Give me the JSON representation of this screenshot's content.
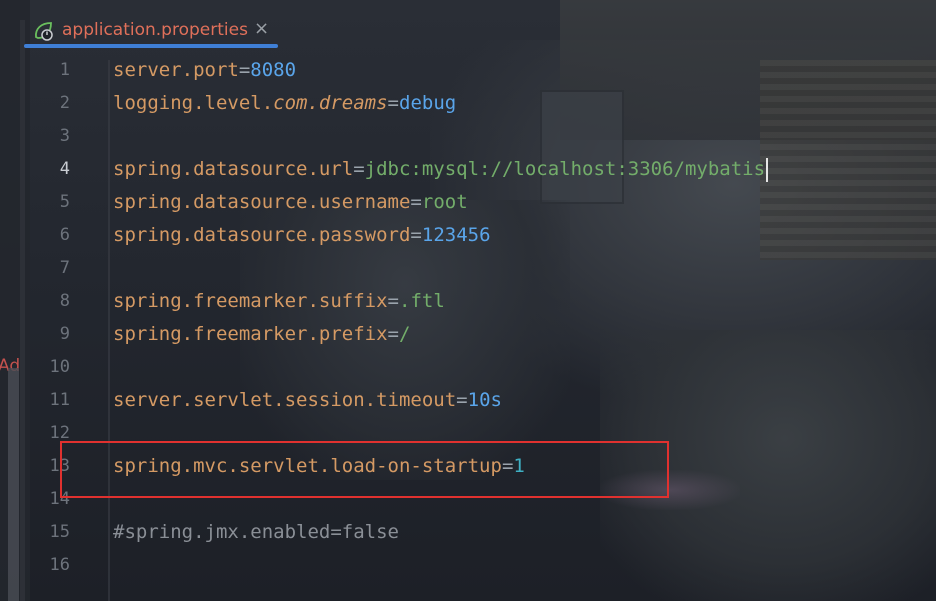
{
  "tab": {
    "label": "application.properties",
    "close": "×",
    "icon": "spring-leaf-icon"
  },
  "sidebar": {
    "cut_text": "Ad"
  },
  "editor": {
    "active_line": 4,
    "lines": [
      {
        "n": "1",
        "key": "server.port",
        "eq": "=",
        "value": "8080"
      },
      {
        "n": "2",
        "key_a": "logging.level.",
        "key_b": "com.dreams",
        "eq": "=",
        "value": "debug"
      },
      {
        "n": "3"
      },
      {
        "n": "4",
        "key": "spring.datasource.url",
        "eq": "=",
        "value": "jdbc:mysql://localhost:3306/mybatis"
      },
      {
        "n": "5",
        "key": "spring.datasource.username",
        "eq": "=",
        "value": "root"
      },
      {
        "n": "6",
        "key": "spring.datasource.password",
        "eq": "=",
        "value": "123456"
      },
      {
        "n": "7"
      },
      {
        "n": "8",
        "key": "spring.freemarker.suffix",
        "eq": "=",
        "value": ".ftl"
      },
      {
        "n": "9",
        "key": "spring.freemarker.prefix",
        "eq": "=",
        "value": "/"
      },
      {
        "n": "10"
      },
      {
        "n": "11",
        "key": "server.servlet.session.timeout",
        "eq": "=",
        "value": "10s"
      },
      {
        "n": "12"
      },
      {
        "n": "13",
        "key": "spring.mvc.servlet.load-on-startup",
        "eq": "=",
        "value": "1"
      },
      {
        "n": "14"
      },
      {
        "n": "15",
        "comment": "#spring.jmx.enabled=false"
      },
      {
        "n": "16"
      }
    ]
  },
  "colors": {
    "highlight": "#e0312f",
    "tab_accent": "#3f7fd6",
    "tab_text": "#e0705a"
  }
}
